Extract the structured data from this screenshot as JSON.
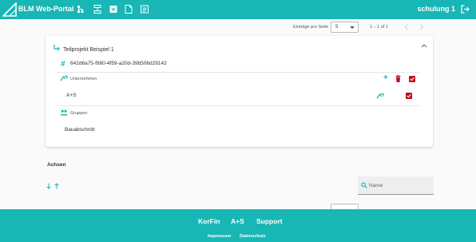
{
  "header": {
    "app_title": "BLM Web-Portal",
    "user_label": "schulung 1",
    "nav_icons": [
      "hierarchy-icon",
      "structure-icon",
      "box-icon",
      "document-icon",
      "list-icon"
    ],
    "brand_color": "#18b6b5"
  },
  "paginator": {
    "items_per_page_label": "Einträge pro Seite",
    "items_per_page_value": "5",
    "range_label": "1 – 1 of 1"
  },
  "card": {
    "title": "Teilprojekt Beispiel 1",
    "id_symbol": "#",
    "guid": "642d6a75-f980-4f59-a20d-39b506d29142",
    "companies_section": {
      "label": "Unternehmen",
      "add_symbol": "+",
      "rows": [
        {
          "name": "A+S",
          "checked": true
        }
      ]
    },
    "groups_section": {
      "label": "Gruppen",
      "rows": [
        {
          "name": "Bauabschnitt"
        }
      ]
    },
    "accent_red": "#c0121f"
  },
  "achsen": {
    "title": "Achsen",
    "search_placeholder": "Name"
  },
  "footer": {
    "links": [
      "KorFin",
      "A+S",
      "Support"
    ],
    "legal_links": [
      "Impressum",
      "Datenschutz"
    ]
  }
}
